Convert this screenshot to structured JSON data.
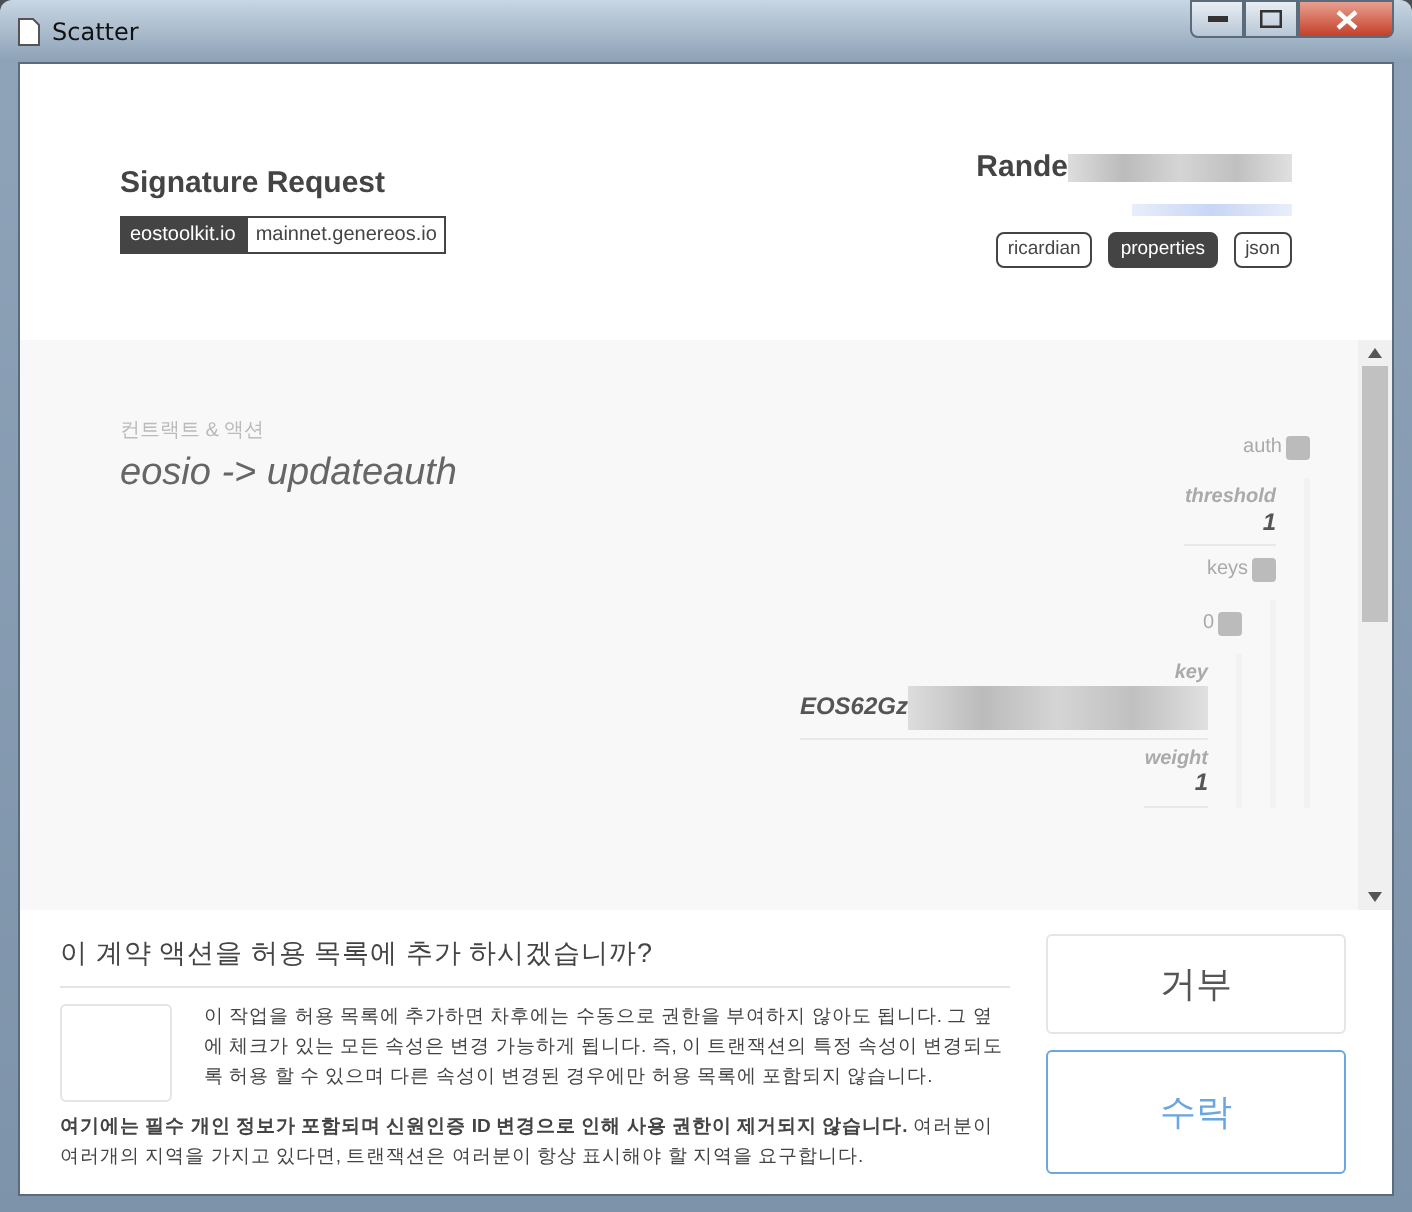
{
  "window": {
    "title": "Scatter"
  },
  "header": {
    "title": "Signature Request",
    "origin": "eostoolkit.io",
    "network": "mainnet.genereos.io",
    "account": "Rande",
    "tabs": [
      {
        "label": "ricardian",
        "selected": false
      },
      {
        "label": "properties",
        "selected": true
      },
      {
        "label": "json",
        "selected": false
      }
    ]
  },
  "action": {
    "caption": "컨트랙트 & 액션",
    "name": "eosio -> updateauth"
  },
  "properties": [
    {
      "kind": "object",
      "label": "auth",
      "checked": false,
      "children": [
        {
          "kind": "value",
          "label": "threshold",
          "value": "1"
        },
        {
          "kind": "object",
          "label": "keys",
          "checked": false,
          "children": [
            {
              "kind": "object",
              "label": "0",
              "checked": false,
              "children": [
                {
                  "kind": "value",
                  "label": "key",
                  "value": "EOS62Gz",
                  "redacted": true
                },
                {
                  "kind": "value",
                  "label": "weight",
                  "value": "1"
                }
              ]
            }
          ]
        }
      ]
    }
  ],
  "whitelist": {
    "question": "이 계약 액션을 허용 목록에 추가 하시겠습니까?",
    "checked": false,
    "description": "이 작업을 허용 목록에 추가하면 차후에는 수동으로 권한을 부여하지 않아도 됩니다. 그 옆에 체크가 있는 모든 속성은 변경 가능하게 됩니다. 즉, 이 트랜잭션의 특정 속성이 변경되도록 허용 할 수 있으며 다른 속성이 변경된 경우에만 허용 목록에 포함되지 않습니다.",
    "notice": "**여기에는 필수 개인 정보가 포함되며 신원인증 ID 변경으로 인해 사용 권한이 제거되지 않습니다.** 여러분이 여러개의 지역을 가지고 있다면, 트랜잭션은 여러분이 항상 표시해야 할 지역을 요구합니다."
  },
  "buttons": [
    {
      "kind": "deny",
      "label": "거부"
    },
    {
      "kind": "accept",
      "label": "수락"
    }
  ]
}
